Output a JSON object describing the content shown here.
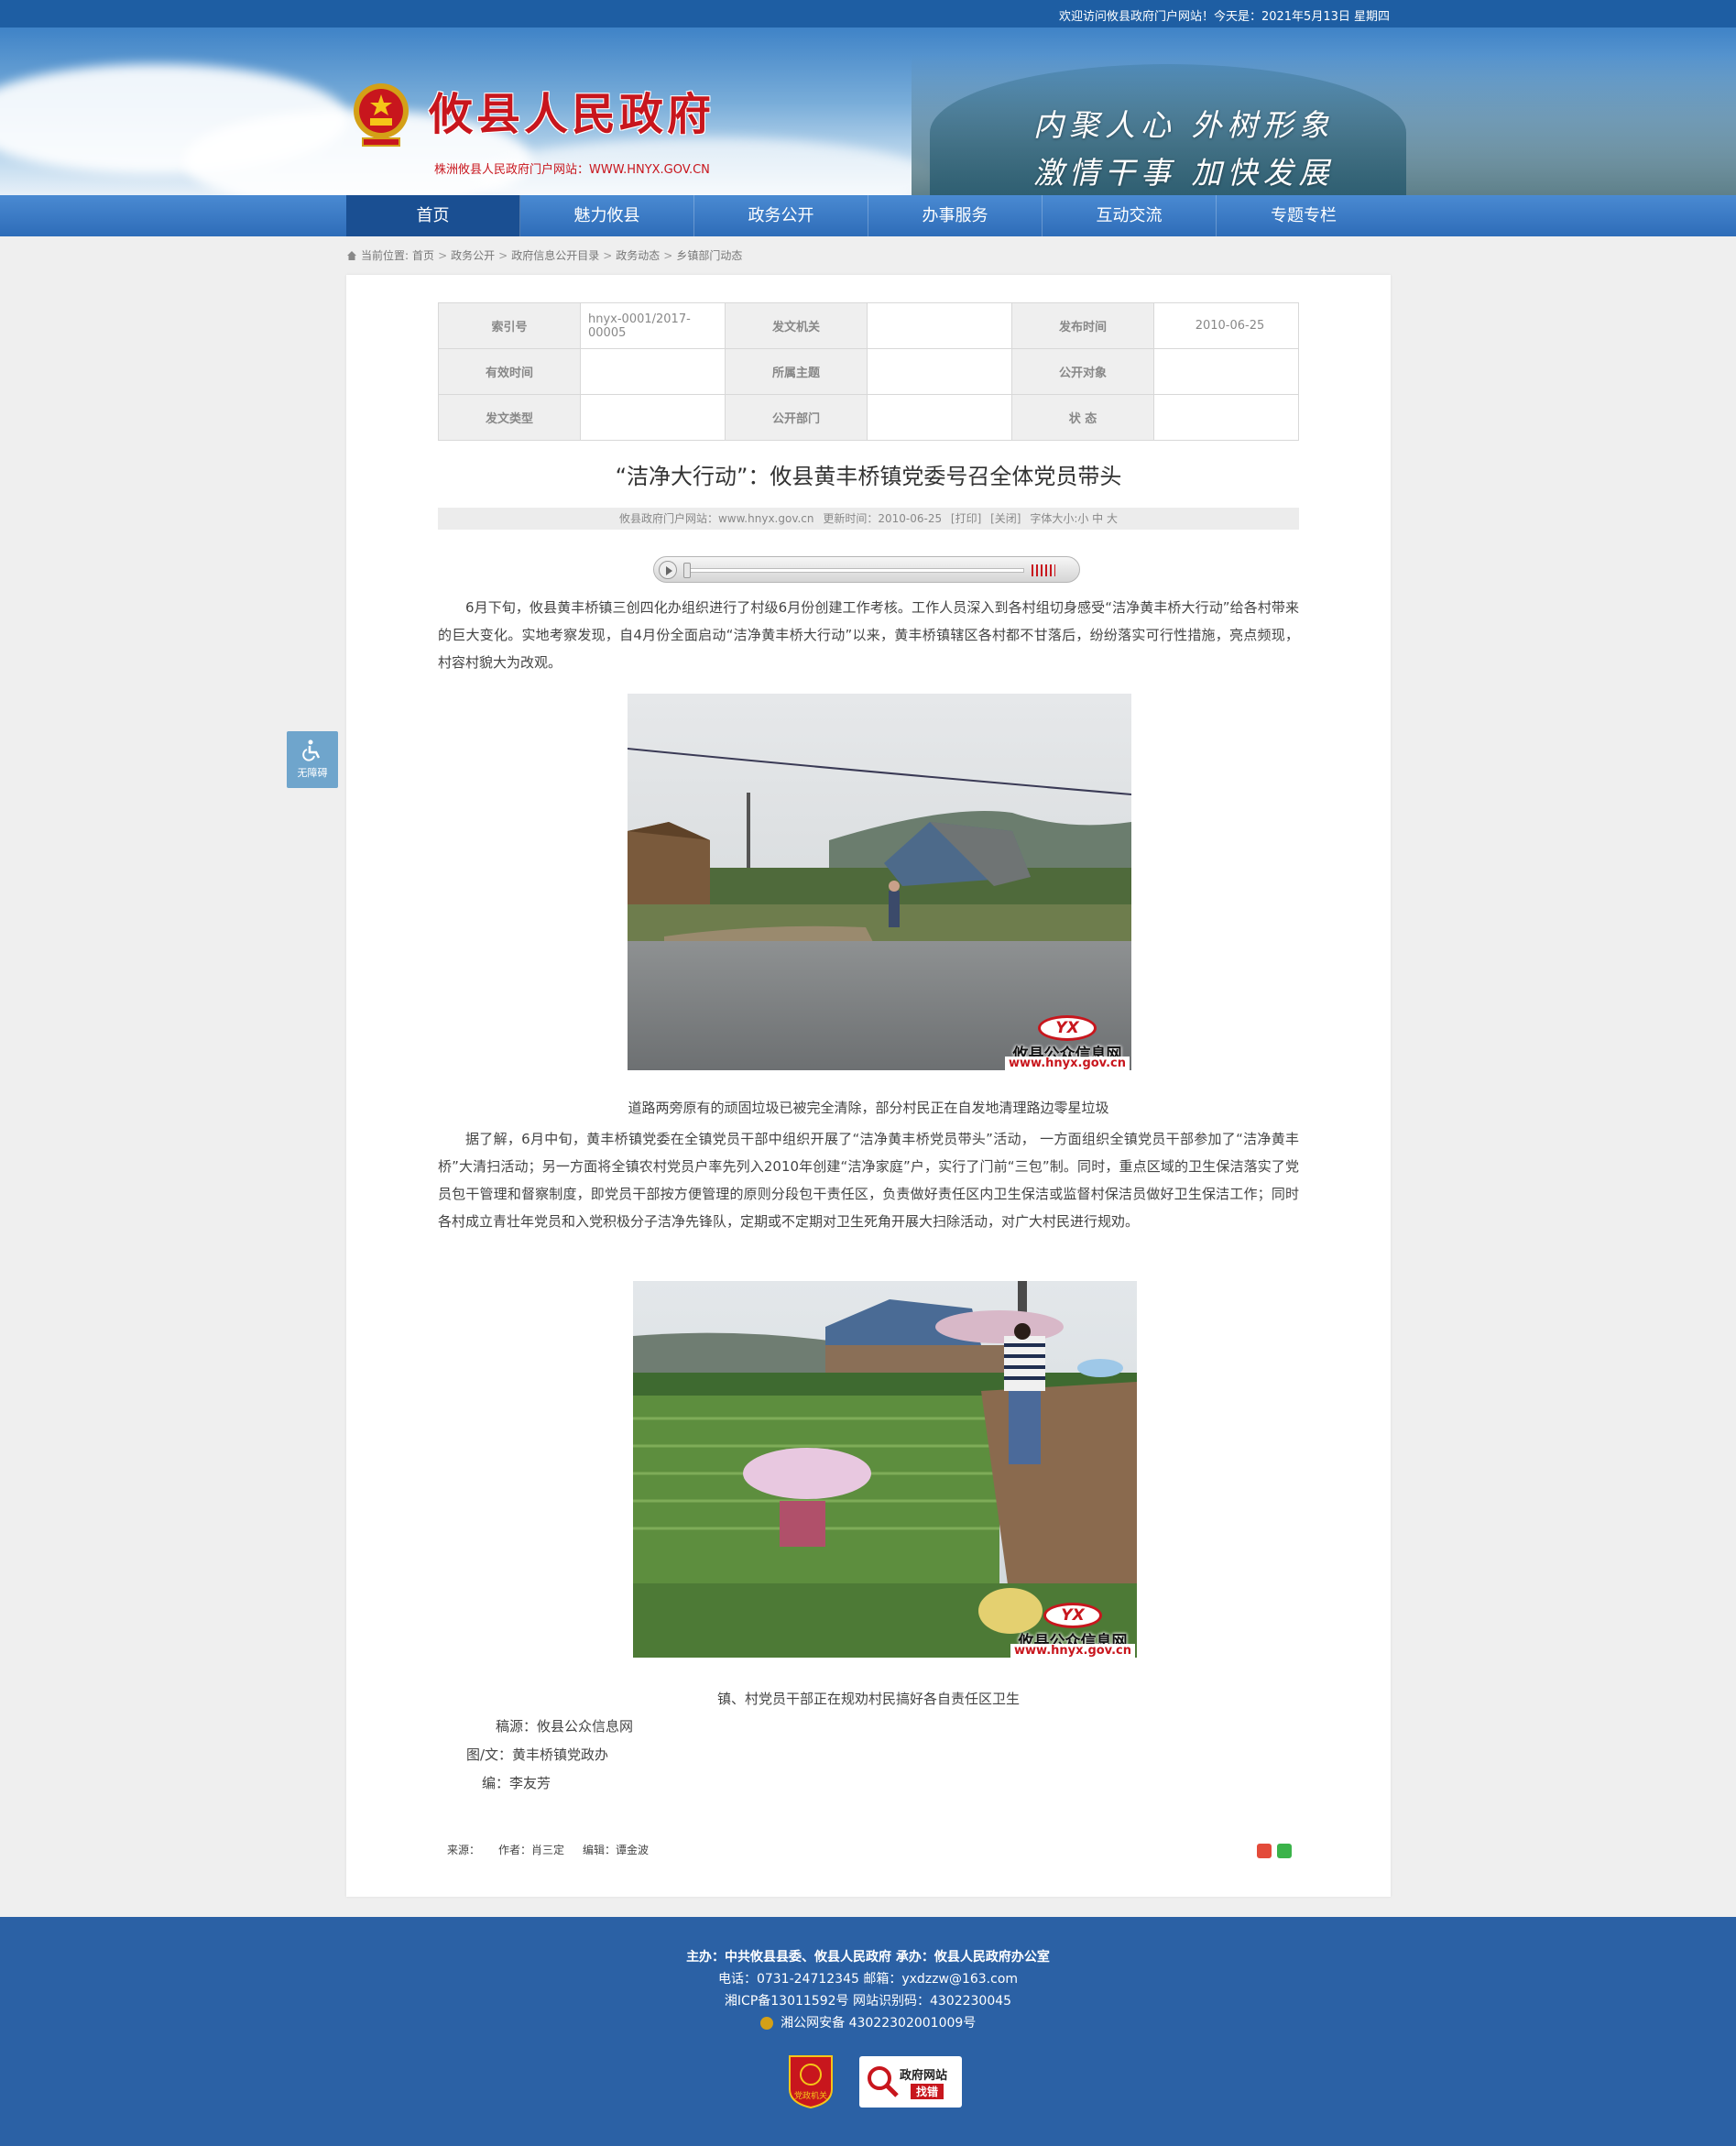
{
  "topbar": {
    "welcome": "欢迎访问攸县政府门户网站！今天是：2021年5月13日 星期四"
  },
  "header": {
    "site_title": "攸县人民政府",
    "site_url": "株洲攸县人民政府门户网站：WWW.HNYX.GOV.CN",
    "slogan_line1": "内聚人心 外树形象",
    "slogan_line2": "激情干事 加快发展"
  },
  "nav": {
    "items": [
      {
        "label": "首页"
      },
      {
        "label": "魅力攸县"
      },
      {
        "label": "政务公开"
      },
      {
        "label": "办事服务"
      },
      {
        "label": "互动交流"
      },
      {
        "label": "专题专栏"
      }
    ]
  },
  "breadcrumb": {
    "prefix": "当前位置:",
    "items": [
      "首页",
      "政务公开",
      "政府信息公开目录",
      "政务动态",
      "乡镇部门动态"
    ]
  },
  "info_table": {
    "k_index": "索引号",
    "v_index": "hnyx-0001/2017-00005",
    "k_issuer": "发文机关",
    "v_issuer": "",
    "k_pubdate": "发布时间",
    "v_pubdate": "2010-06-25",
    "k_valid": "有效时间",
    "v_valid": "",
    "k_topic": "所属主题",
    "v_topic": "",
    "k_audience": "公开对象",
    "v_audience": "",
    "k_doctype": "发文类型",
    "v_doctype": "",
    "k_dept": "公开部门",
    "v_dept": "",
    "k_status": "状 态",
    "v_status": ""
  },
  "article": {
    "title": "“洁净大行动”：攸县黄丰桥镇党委号召全体党员带头",
    "meta_site": "攸县政府门户网站：www.hnyx.gov.cn",
    "meta_updated": "更新时间：2010-06-25",
    "meta_print": "[打印]",
    "meta_close": "[关闭]",
    "meta_font": "字体大小:小 中 大",
    "para1": "6月下旬，攸县黄丰桥镇三创四化办组织进行了村级6月份创建工作考核。工作人员深入到各村组切身感受“洁净黄丰桥大行动”给各村带来的巨大变化。实地考察发现，自4月份全面启动“洁净黄丰桥大行动”以来，黄丰桥镇辖区各村都不甘落后，纷纷落实可行性措施，亮点频现，村容村貌大为改观。",
    "caption1": "道路两旁原有的顽固垃圾已被完全清除，部分村民正在自发地清理路边零星垃圾",
    "para2": "据了解，6月中旬，黄丰桥镇党委在全镇党员干部中组织开展了“洁净黄丰桥党员带头”活动， 一方面组织全镇党员干部参加了“洁净黄丰桥”大清扫活动；另一方面将全镇农村党员户率先列入2010年创建“洁净家庭”户，实行了门前“三包”制。同时，重点区域的卫生保洁落实了党员包干管理和督察制度，即党员干部按方便管理的原则分段包干责任区，负责做好责任区内卫生保洁或监督村保洁员做好卫生保洁工作；同时各村成立青壮年党员和入党积极分子洁净先锋队，定期或不定期对卫生死角开展大扫除活动，对广大村民进行规劝。",
    "caption2": "镇、村党员干部正在规劝村民搞好各自责任区卫生",
    "credit_source": "稿源：攸县公众信息网",
    "credit_author": "图/文：黄丰桥镇党政办",
    "credit_editor": "编：李友芳",
    "watermark_logo": "YX",
    "watermark_name": "攸县公众信息网",
    "watermark_url": "www.hnyx.gov.cn",
    "footer_source": "来源：",
    "footer_author": "作者：肖三定",
    "footer_editor": "编辑：谭金波"
  },
  "accessibility": {
    "label": "无障碍"
  },
  "footer": {
    "line1": "主办：中共攸县县委、攸县人民政府 承办：攸县人民政府办公室",
    "line2": "电话：0731-24712345 邮箱：yxdzzw@163.com",
    "line3": "湘ICP备13011592号   网站识别码：4302230045",
    "line4": "湘公网安备 43022302001009号",
    "badge1_label": "党政机关",
    "badge2_line1": "政府网站",
    "badge2_line2": "找错"
  },
  "colors": {
    "brand_red": "#c8161d",
    "nav_blue": "#2e6cb8",
    "footer_blue": "#2b61a5"
  }
}
